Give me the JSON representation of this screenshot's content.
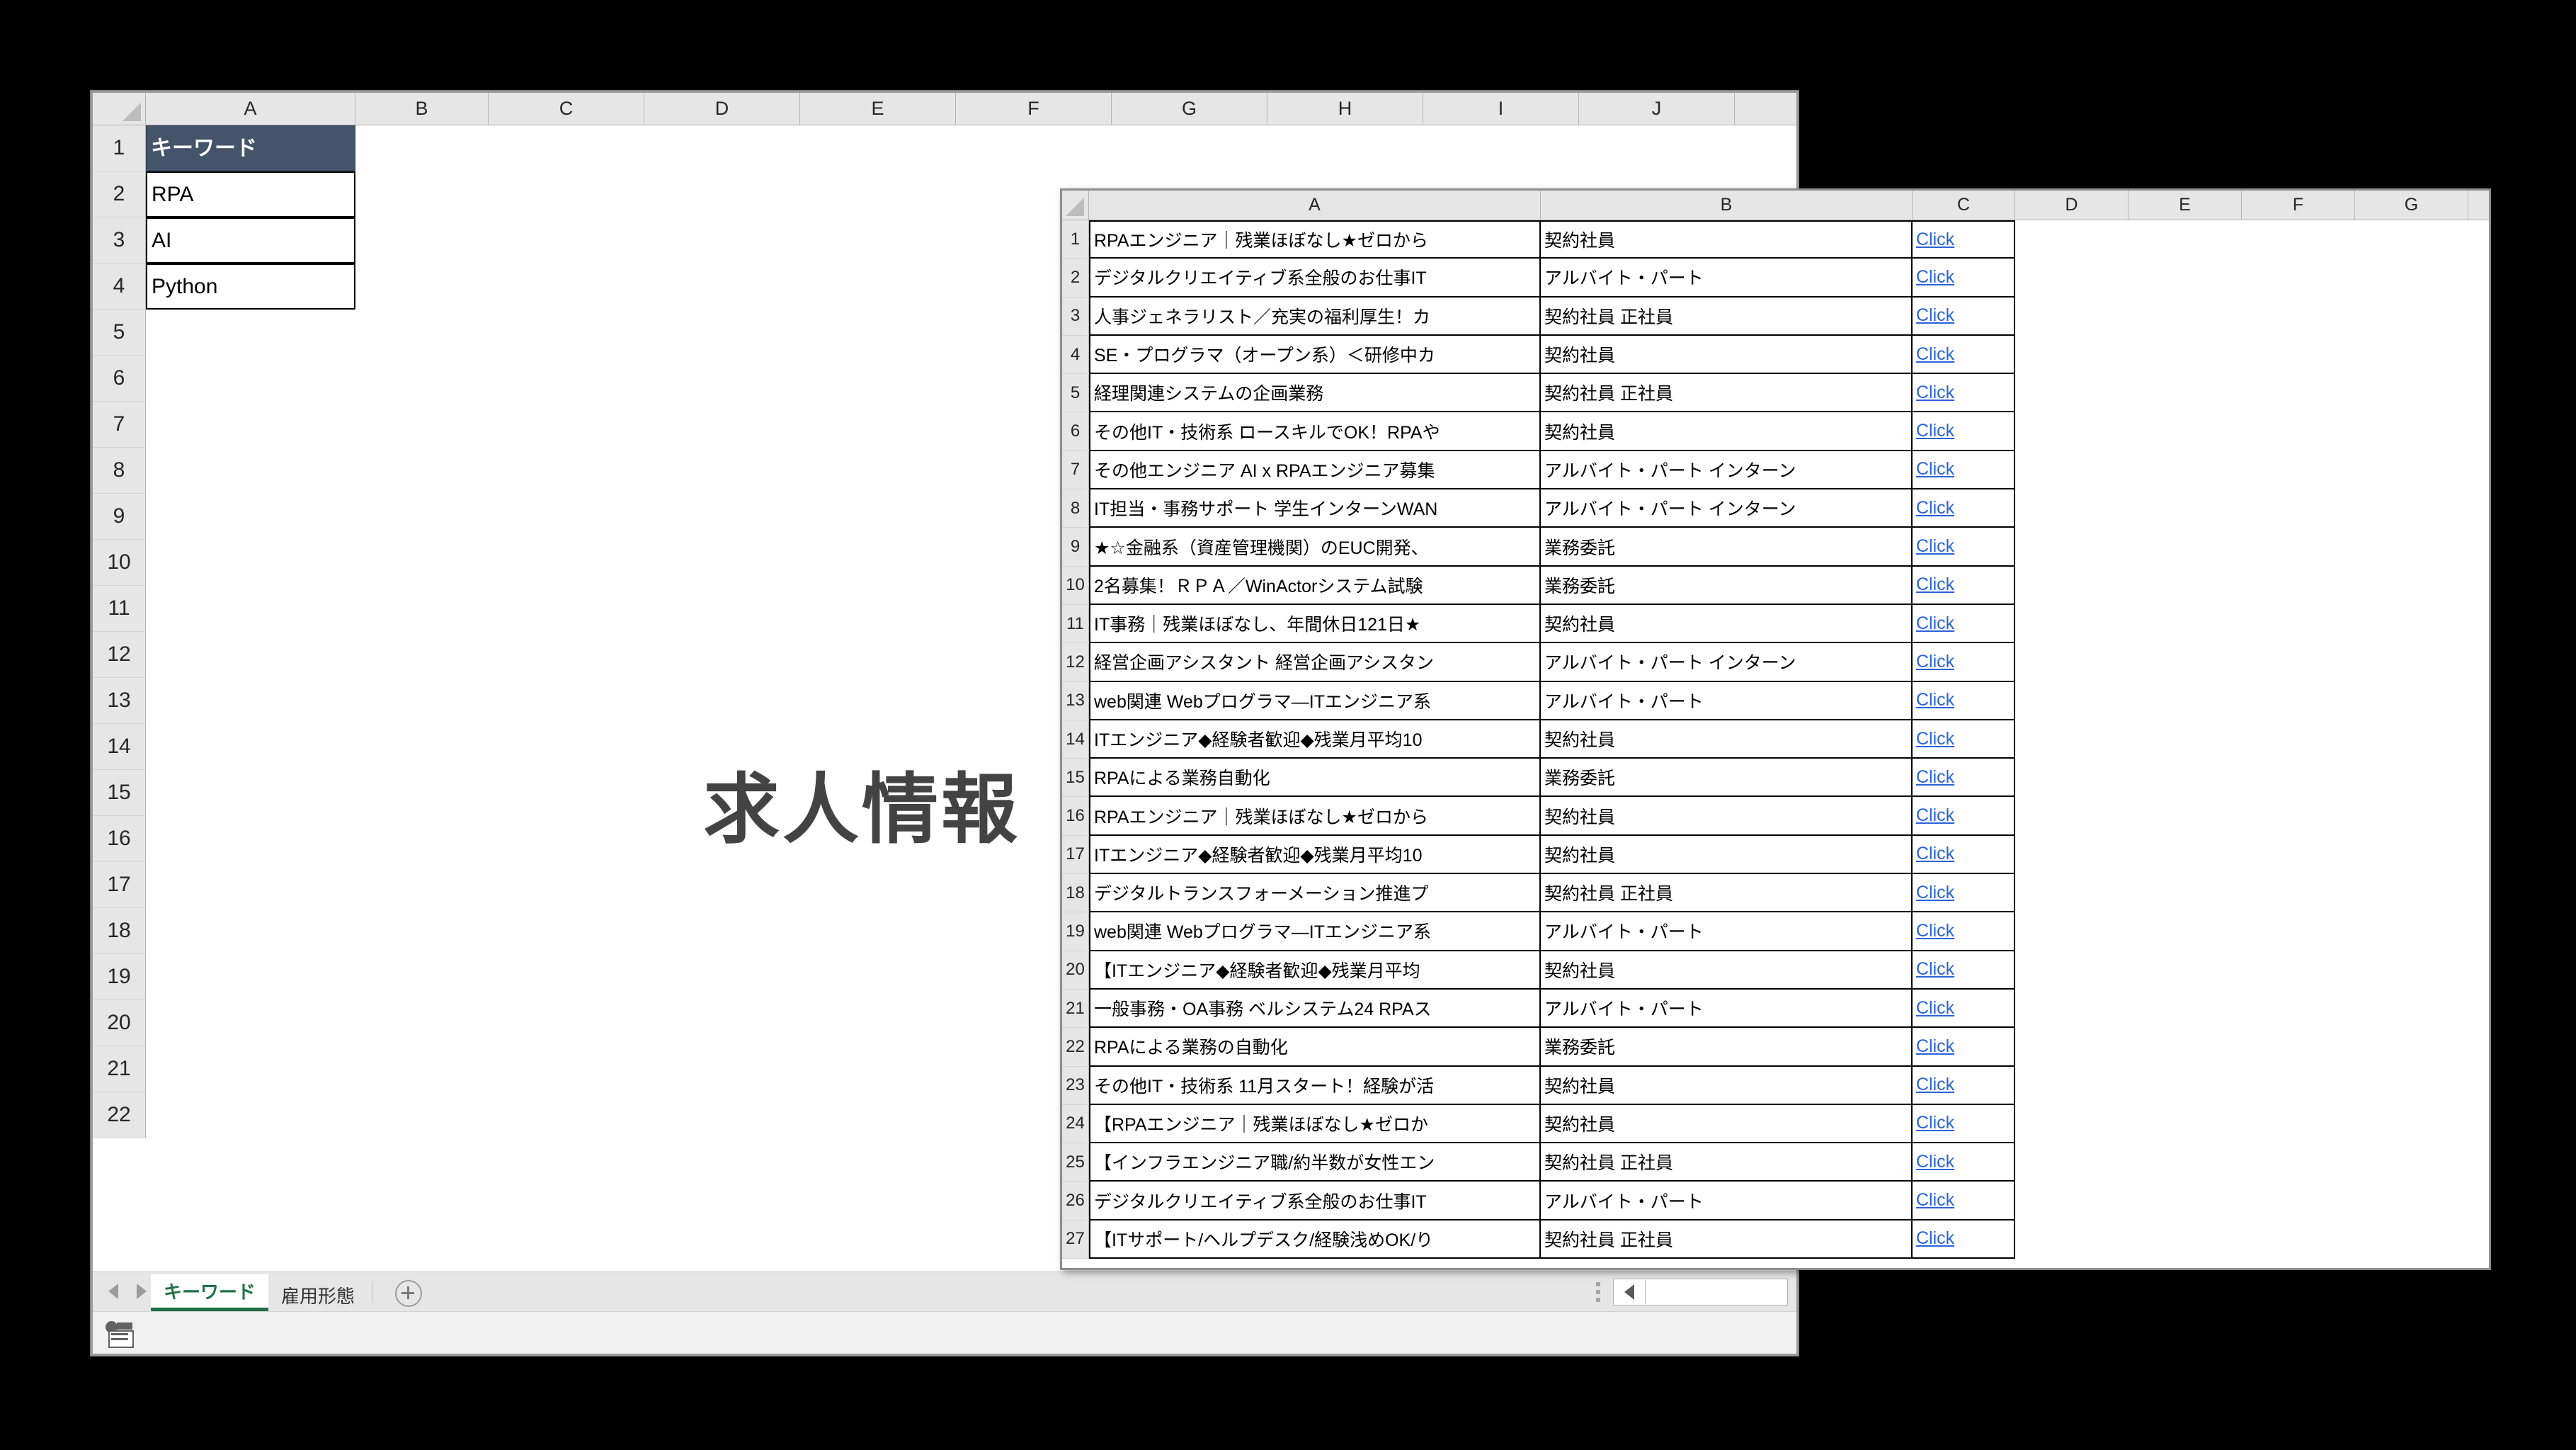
{
  "back_window": {
    "name": "keyword-sheet-window",
    "columns": [
      "A",
      "B",
      "C",
      "D",
      "E",
      "F",
      "G",
      "H",
      "I",
      "J"
    ],
    "row_numbers": [
      "1",
      "2",
      "3",
      "4",
      "5",
      "6",
      "7",
      "8",
      "9",
      "10",
      "11",
      "12",
      "13",
      "14",
      "15",
      "16",
      "17",
      "18",
      "19",
      "20",
      "21",
      "22"
    ],
    "cells_A": [
      "キーワード",
      "RPA",
      "AI",
      "Python"
    ],
    "header_fill": "#44546A",
    "header_text_color": "#FFFFFF",
    "watermark": "求人情報",
    "watermark_color": "#434343",
    "sheet_tabs": [
      {
        "label": "キーワード",
        "active": true
      },
      {
        "label": "雇用形態",
        "active": false
      }
    ],
    "add_sheet_icon": "plus-circle-icon",
    "nav_prev_icon": "triangle-left-icon",
    "nav_next_icon": "triangle-right-icon",
    "hscroll_left_icon": "triangle-left-icon",
    "status_icon": "workbook-statistics-icon",
    "active_tab_color": "#217346"
  },
  "front_window": {
    "name": "job-listings-window",
    "columns": [
      "A",
      "B",
      "C",
      "D",
      "E",
      "F",
      "G"
    ],
    "link_color": "#2A64D8",
    "link_label": "Click",
    "rows": [
      {
        "n": "1",
        "a": "RPAエンジニア｜残業ほぼなし★ゼロから",
        "b": "契約社員",
        "c": "Click"
      },
      {
        "n": "2",
        "a": "デジタルクリエイティブ系全般のお仕事IT",
        "b": "アルバイト・パート",
        "c": "Click"
      },
      {
        "n": "3",
        "a": "人事ジェネラリスト／充実の福利厚生！カ",
        "b": "契約社員 正社員",
        "c": "Click"
      },
      {
        "n": "4",
        "a": "SE・プログラマ（オープン系）＜研修中カ",
        "b": "契約社員",
        "c": "Click"
      },
      {
        "n": "5",
        "a": "経理関連システムの企画業務",
        "b": "契約社員 正社員",
        "c": "Click"
      },
      {
        "n": "6",
        "a": "その他IT・技術系 ロースキルでOK！RPAや",
        "b": "契約社員",
        "c": "Click"
      },
      {
        "n": "7",
        "a": "その他エンジニア AI x RPAエンジニア募集",
        "b": "アルバイト・パート インターン",
        "c": "Click"
      },
      {
        "n": "8",
        "a": "IT担当・事務サポート 学生インターンWAN",
        "b": "アルバイト・パート インターン",
        "c": "Click"
      },
      {
        "n": "9",
        "a": "★☆金融系（資産管理機関）のEUC開発、",
        "b": "業務委託",
        "c": "Click"
      },
      {
        "n": "10",
        "a": "2名募集！ＲＰＡ／WinActorシステム試験",
        "b": "業務委託",
        "c": "Click"
      },
      {
        "n": "11",
        "a": "IT事務｜残業ほぼなし、年間休日121日★",
        "b": "契約社員",
        "c": "Click"
      },
      {
        "n": "12",
        "a": "経営企画アシスタント 経営企画アシスタン",
        "b": "アルバイト・パート インターン",
        "c": "Click"
      },
      {
        "n": "13",
        "a": "web関連 Webプログラマ―ITエンジニア系",
        "b": "アルバイト・パート",
        "c": "Click"
      },
      {
        "n": "14",
        "a": "ITエンジニア◆経験者歓迎◆残業月平均10",
        "b": "契約社員",
        "c": "Click"
      },
      {
        "n": "15",
        "a": "RPAによる業務自動化",
        "b": "業務委託",
        "c": "Click"
      },
      {
        "n": "16",
        "a": "RPAエンジニア｜残業ほぼなし★ゼロから",
        "b": "契約社員",
        "c": "Click"
      },
      {
        "n": "17",
        "a": "ITエンジニア◆経験者歓迎◆残業月平均10",
        "b": "契約社員",
        "c": "Click"
      },
      {
        "n": "18",
        "a": "デジタルトランスフォーメーション推進プ",
        "b": "契約社員 正社員",
        "c": "Click"
      },
      {
        "n": "19",
        "a": "web関連 Webプログラマ―ITエンジニア系",
        "b": "アルバイト・パート",
        "c": "Click"
      },
      {
        "n": "20",
        "a": "【ITエンジニア◆経験者歓迎◆残業月平均",
        "b": "契約社員",
        "c": "Click"
      },
      {
        "n": "21",
        "a": "一般事務・OA事務 ベルシステム24 RPAス",
        "b": "アルバイト・パート",
        "c": "Click"
      },
      {
        "n": "22",
        "a": "RPAによる業務の自動化",
        "b": "業務委託",
        "c": "Click"
      },
      {
        "n": "23",
        "a": "その他IT・技術系 11月スタート！経験が活",
        "b": "契約社員",
        "c": "Click"
      },
      {
        "n": "24",
        "a": "【RPAエンジニア｜残業ほぼなし★ゼロか",
        "b": "契約社員",
        "c": "Click"
      },
      {
        "n": "25",
        "a": "【インフラエンジニア職/約半数が女性エン",
        "b": "契約社員 正社員",
        "c": "Click"
      },
      {
        "n": "26",
        "a": "デジタルクリエイティブ系全般のお仕事IT",
        "b": "アルバイト・パート",
        "c": "Click"
      },
      {
        "n": "27",
        "a": "【ITサポート/ヘルプデスク/経験浅めOK/り",
        "b": "契約社員 正社員",
        "c": "Click"
      }
    ]
  }
}
